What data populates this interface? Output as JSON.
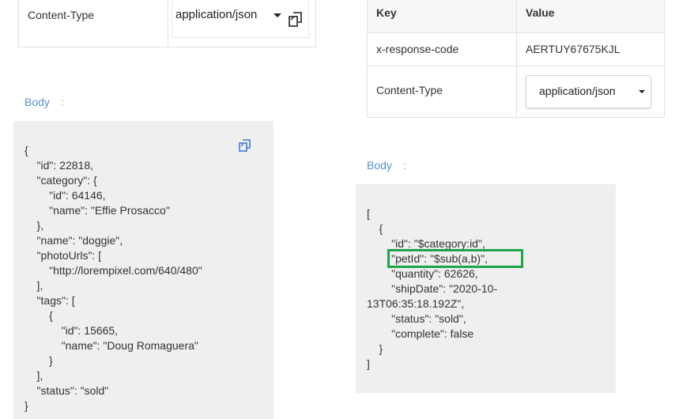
{
  "request": {
    "header": {
      "key": "Content-Type",
      "value": "application/json"
    },
    "body": {
      "label": "Body",
      "colon": ":",
      "lines": [
        "{",
        "    \"id\": 22818,",
        "    \"category\": {",
        "        \"id\": 64146,",
        "        \"name\": \"Effie Prosacco\"",
        "    },",
        "    \"name\": \"doggie\",",
        "    \"photoUrls\": [",
        "        \"http://lorempixel.com/640/480\"",
        "    ],",
        "    \"tags\": [",
        "        {",
        "            \"id\": 15665,",
        "            \"name\": \"Doug Romaguera\"",
        "        }",
        "    ],",
        "    \"status\": \"sold\"",
        "}"
      ]
    }
  },
  "response": {
    "headers_table": {
      "col_key": "Key",
      "col_value": "Value",
      "rows": [
        {
          "key": "x-response-code",
          "value": "AERTUY67675KJL"
        },
        {
          "key": "Content-Type",
          "value": "application/json"
        }
      ]
    },
    "body": {
      "label": "Body",
      "colon": ":",
      "lines": [
        "[",
        "    {",
        "        \"id\": \"$category:id\",",
        "        \"petId\": \"$sub(a,b)\",",
        "        \"quantity\": 62626,",
        "        \"shipDate\": \"2020-10-",
        "13T06:35:18.192Z\",",
        "        \"status\": \"sold\",",
        "        \"complete\": false",
        "    }",
        "]"
      ]
    }
  },
  "colors": {
    "accent_blue": "#5b8fd1",
    "highlight_green": "#1ea34a",
    "code_bg": "#efefef"
  },
  "icons": {
    "copy": "copy-icon",
    "dropdown": "chevron-down-icon"
  }
}
